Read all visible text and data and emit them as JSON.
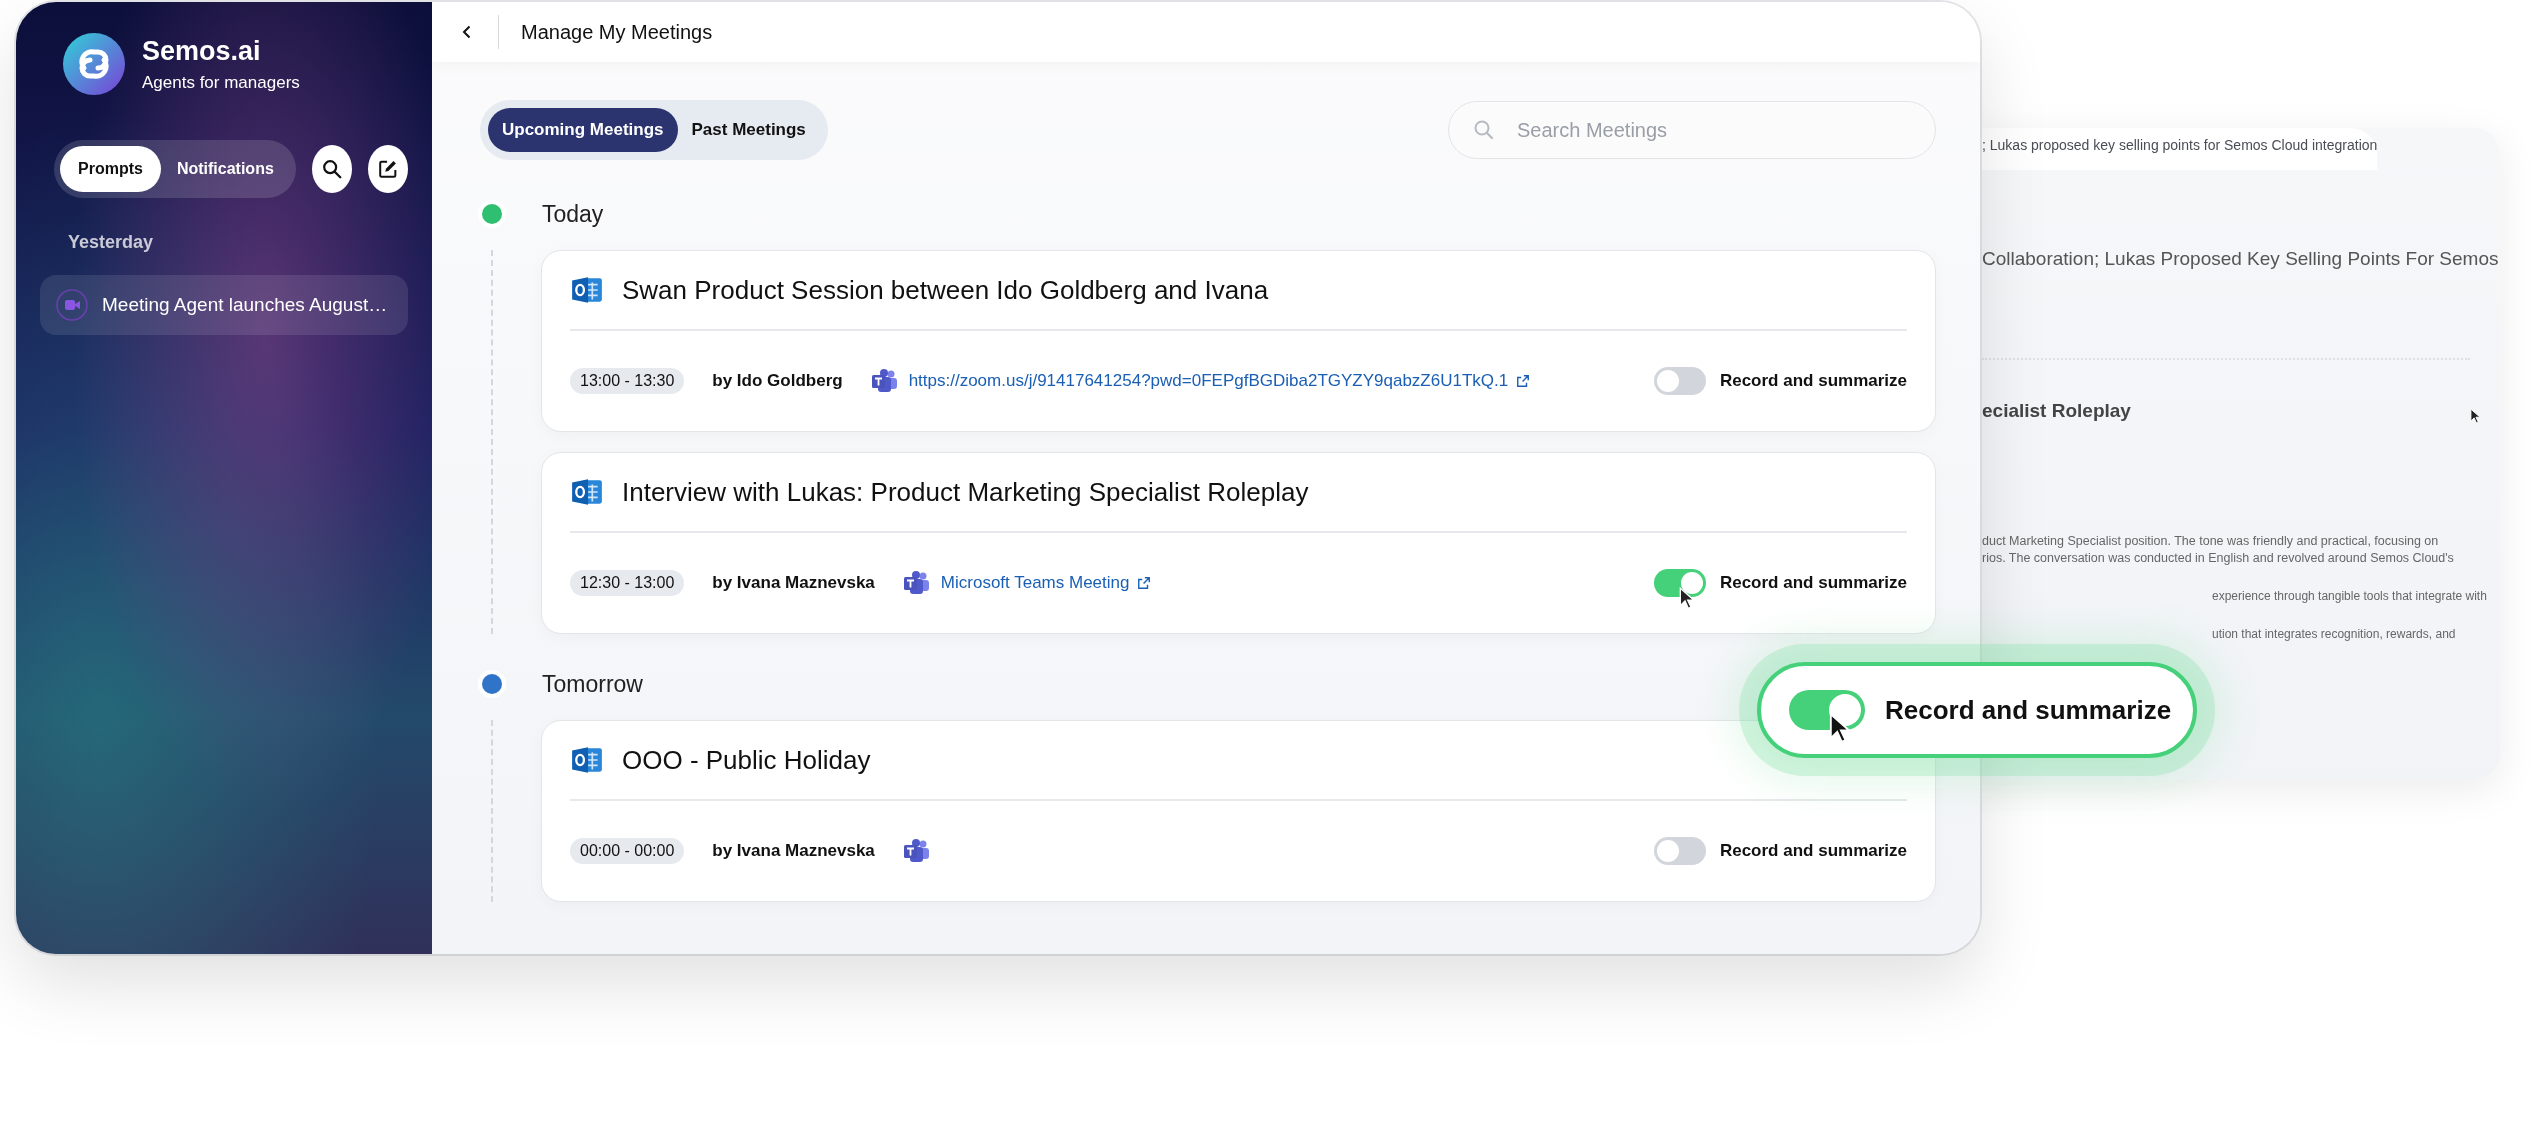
{
  "app": {
    "name": "Semos.ai",
    "tagline": "Agents for managers"
  },
  "sidebar": {
    "tabs": [
      {
        "label": "Prompts",
        "selected": true
      },
      {
        "label": "Notifications",
        "selected": false
      }
    ],
    "sections": [
      {
        "heading": "Yesterday",
        "items": [
          {
            "label": "Meeting Agent launches August…"
          }
        ]
      }
    ]
  },
  "header": {
    "title": "Manage My Meetings"
  },
  "meeting_tabs": [
    {
      "label": "Upcoming Meetings",
      "selected": true
    },
    {
      "label": "Past Meetings",
      "selected": false
    }
  ],
  "search": {
    "placeholder": "Search Meetings"
  },
  "groups": [
    {
      "label": "Today",
      "color": "#2fbf71",
      "meetings": [
        {
          "title": "Swan Product Session between Ido Goldberg and Ivana",
          "time": "13:00 - 13:30",
          "organizer": "by Ido Goldberg",
          "link": "https://zoom.us/j/91417641254?pwd=0FEPgfBGDiba2TGYZY9qabzZ6U1TkQ.1",
          "record": false,
          "toggle_label": "Record and summarize"
        },
        {
          "title": "Interview with Lukas: Product Marketing Specialist Roleplay",
          "time": "12:30 - 13:00",
          "organizer": "by Ivana Maznevska",
          "link": "Microsoft Teams Meeting",
          "record": true,
          "toggle_label": "Record and summarize"
        }
      ]
    },
    {
      "label": "Tomorrow",
      "color": "#2f74c8",
      "meetings": [
        {
          "title": "OOO - Public Holiday",
          "time": "00:00 - 00:00",
          "organizer": "by Ivana Maznevska",
          "record": false,
          "toggle_label": "Record and summarize"
        }
      ]
    }
  ],
  "background_panel": {
    "lines": [
      {
        "kind": "top",
        "text": "; Lukas proposed key selling points for Semos Cloud integration"
      },
      {
        "kind": "large",
        "text": "Collaboration; Lukas Proposed Key Selling Points For Semos"
      },
      {
        "kind": "heading",
        "text": "ecialist Roleplay"
      },
      {
        "kind": "body",
        "text": "duct Marketing Specialist position. The tone was friendly and practical, focusing on"
      },
      {
        "kind": "body",
        "text": "rios. The conversation was conducted in English and revolved around Semos Cloud's"
      },
      {
        "kind": "body-offset",
        "text": "experience through tangible tools that integrate with"
      },
      {
        "kind": "body-offset",
        "text": "ution that integrates recognition, rewards, and"
      }
    ]
  },
  "callout": {
    "label": "Record and summarize",
    "on": true
  }
}
